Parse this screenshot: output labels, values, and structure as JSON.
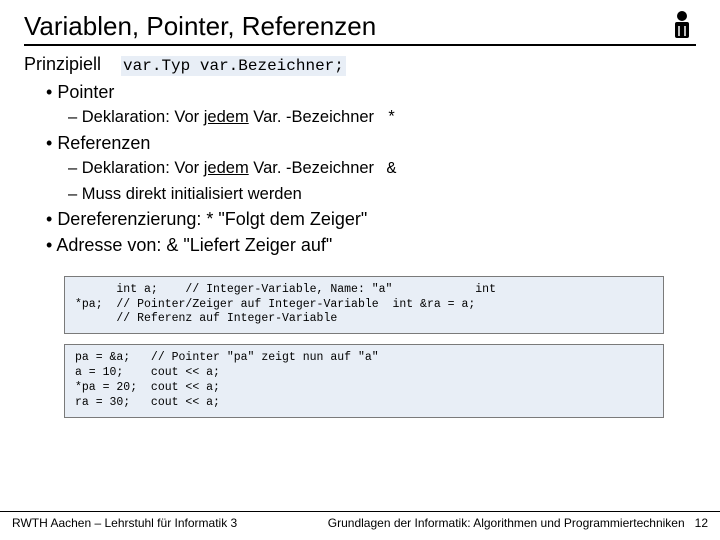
{
  "title": "Variablen, Pointer, Referenzen",
  "intro_word": "Prinzipiell",
  "intro_code": "var.Typ var.Bezeichner;",
  "pointer_heading": "Pointer",
  "pointer_decl_prefix": "Deklaration: Vor ",
  "pointer_decl_underlined": "jedem",
  "pointer_decl_suffix": " Var. -Bezeichner",
  "pointer_symbol": "*",
  "ref_heading": "Referenzen",
  "ref_decl_prefix": "Deklaration: Vor ",
  "ref_decl_underlined": "jedem",
  "ref_decl_suffix": " Var. -Bezeichner",
  "ref_symbol": "&",
  "ref_init": "Muss direkt initialisiert werden",
  "deref_line": "Dereferenzierung: * \"Folgt dem Zeiger\"",
  "addr_line": "Adresse von: & \"Liefert Zeiger auf\"",
  "code1": "      int a;    // Integer-Variable, Name: \"a\"            int\n*pa;  // Pointer/Zeiger auf Integer-Variable  int &ra = a;\n      // Referenz auf Integer-Variable",
  "code2": "pa = &a;   // Pointer \"pa\" zeigt nun auf \"a\"\na = 10;    cout << a;\n*pa = 20;  cout << a;\nra = 30;   cout << a;",
  "footer_left": "RWTH Aachen – Lehrstuhl für Informatik 3",
  "footer_right": "Grundlagen der Informatik: Algorithmen und Programmiertechniken",
  "page_number": "12"
}
